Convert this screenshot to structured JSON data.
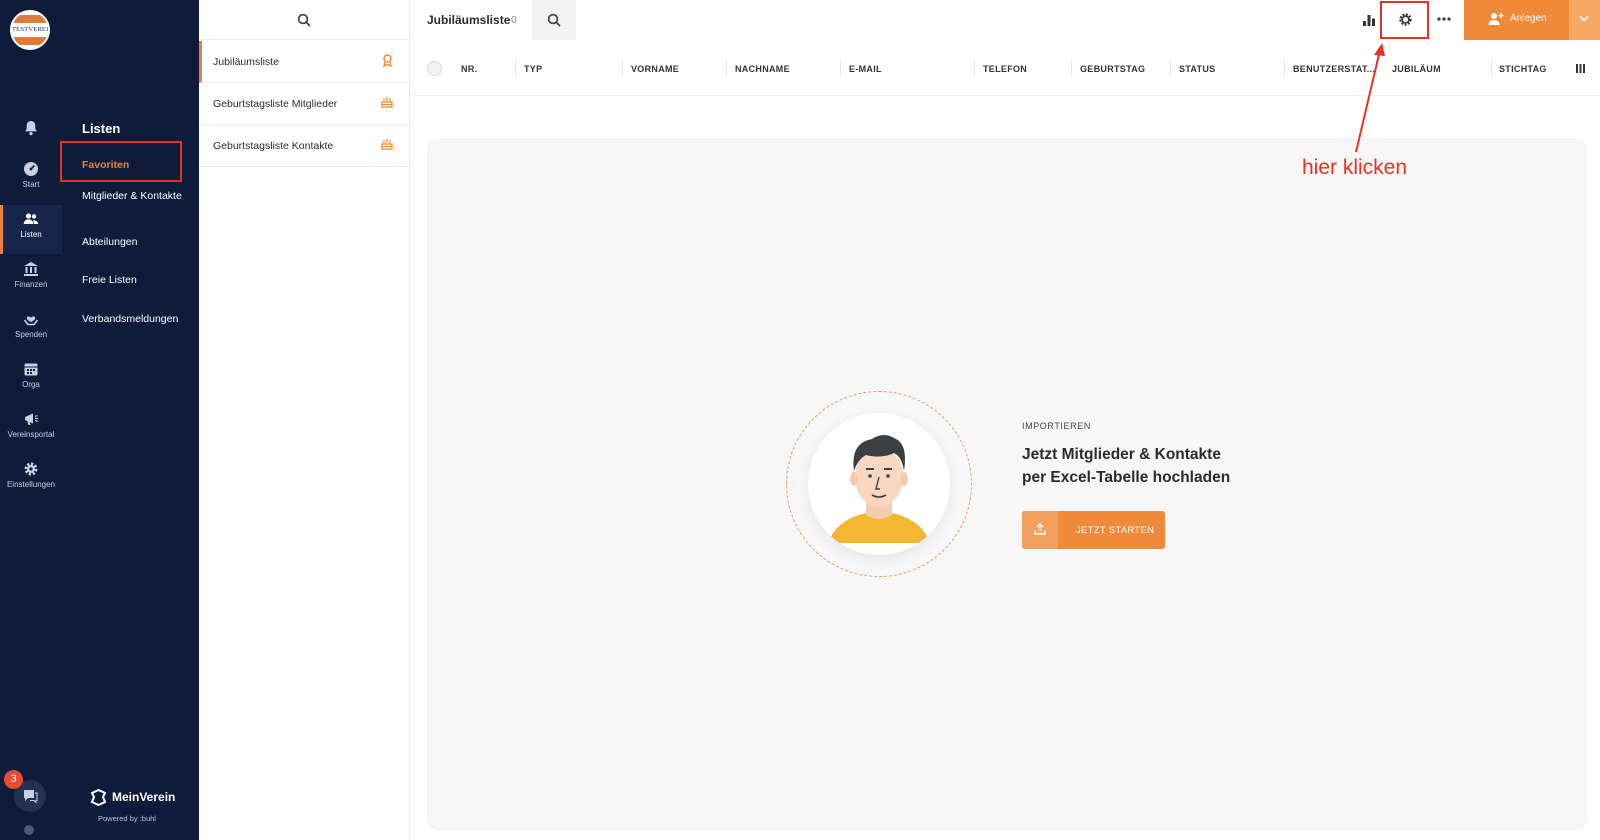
{
  "app": {
    "logo_text": "TESTVEREIN",
    "accent_color": "#ef8a3b",
    "nav_bg": "#0e1b3a"
  },
  "rail": {
    "items": [
      {
        "label": "Start",
        "icon": "dashboard-icon"
      },
      {
        "label": "Listen",
        "icon": "users-icon"
      },
      {
        "label": "Finanzen",
        "icon": "bank-icon"
      },
      {
        "label": "Spenden",
        "icon": "heart-hand-icon"
      },
      {
        "label": "Orga",
        "icon": "calendar-icon"
      },
      {
        "label": "Vereinsportal",
        "icon": "megaphone-icon"
      },
      {
        "label": "Einstellungen",
        "icon": "gear-icon"
      }
    ],
    "chat_badge": "3"
  },
  "nav2": {
    "title": "Listen",
    "items": [
      "Favoriten",
      "Mitglieder & Kontakte",
      "Abteilungen",
      "Freie Listen",
      "Verbandsmeldungen"
    ],
    "brand": "MeinVerein",
    "powered": "Powered by :buhl"
  },
  "lists": {
    "items": [
      {
        "label": "Jubiläumsliste",
        "icon": "award-icon"
      },
      {
        "label": "Geburtstagsliste Mitglieder",
        "icon": "cake-icon"
      },
      {
        "label": "Geburtstagsliste Kontakte",
        "icon": "cake-icon"
      }
    ]
  },
  "main": {
    "title": "Jubiläumsliste",
    "count": "0",
    "anlegen_label": "Anlegen",
    "columns": [
      "NR.",
      "TYP",
      "VORNAME",
      "NACHNAME",
      "E-MAIL",
      "TELEFON",
      "GEBURTSTAG",
      "STATUS",
      "BENUTZERSTAT...",
      "JUBILÄUM",
      "STICHTAG"
    ],
    "import_kicker": "IMPORTIEREN",
    "import_title_1": "Jetzt Mitglieder & Kontakte",
    "import_title_2": "per Excel-Tabelle hochladen",
    "start_label": "JETZT STARTEN"
  },
  "annotation": {
    "text": "hier klicken",
    "color": "#e53322"
  }
}
